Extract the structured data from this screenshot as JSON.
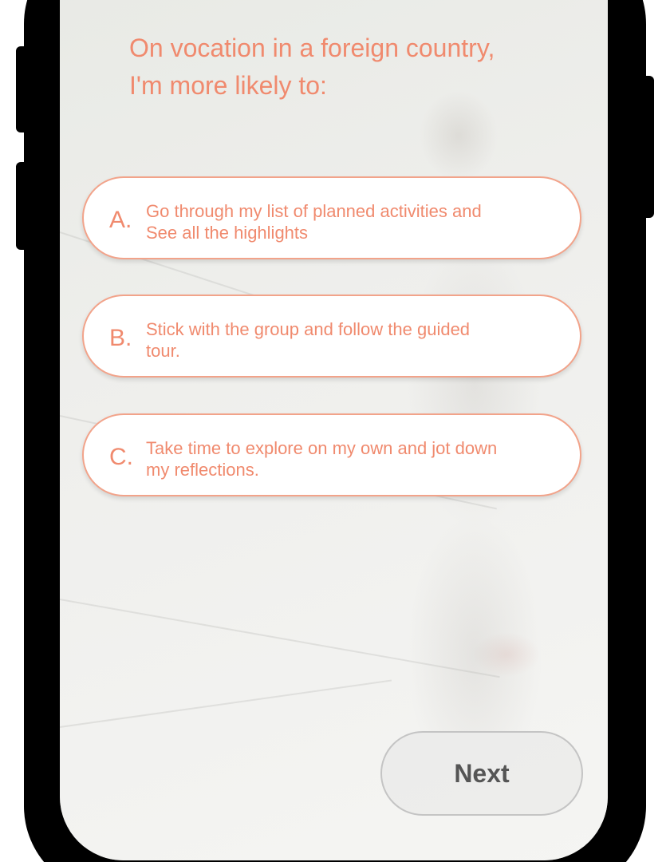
{
  "question": {
    "line1": "On vocation in a foreign country,",
    "line2": "I'm more likely to:"
  },
  "options": [
    {
      "letter": "A.",
      "line1": "Go through my list of planned activities and",
      "line2": "See all the highlights"
    },
    {
      "letter": "B.",
      "line1": "Stick with the group and follow the guided",
      "line2": "tour."
    },
    {
      "letter": "C.",
      "line1": "Take time to explore on my own and jot down",
      "line2": "my reflections."
    }
  ],
  "next_button": {
    "label": "Next"
  },
  "colors": {
    "accent": "#f08a6e",
    "option_border": "#f2a38a",
    "button_text": "#555555"
  }
}
